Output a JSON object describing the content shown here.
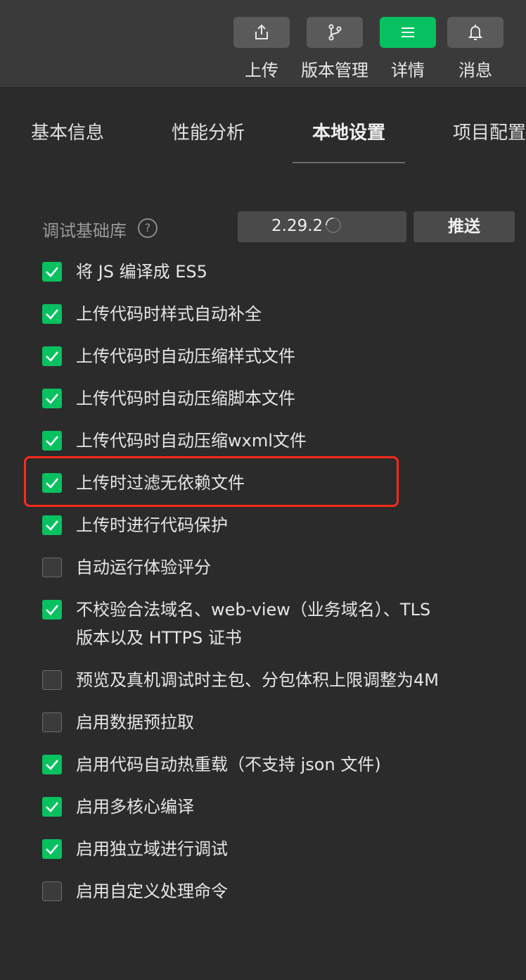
{
  "toolbar": {
    "buttons": [
      {
        "label": "上传",
        "icon": "upload-icon"
      },
      {
        "label": "版本管理",
        "icon": "branch-icon"
      },
      {
        "label": "详情",
        "icon": "menu-icon",
        "active": true
      },
      {
        "label": "消息",
        "icon": "bell-icon"
      }
    ]
  },
  "tabs": [
    "基本信息",
    "性能分析",
    "本地设置",
    "项目配置"
  ],
  "active_tab": "本地设置",
  "debug_lib": {
    "label": "调试基础库",
    "help": "?",
    "version": "2.29.2",
    "push_label": "推送"
  },
  "options": [
    {
      "label": "将 JS 编译成 ES5",
      "checked": true
    },
    {
      "label": "上传代码时样式自动补全",
      "checked": true
    },
    {
      "label": "上传代码时自动压缩样式文件",
      "checked": true
    },
    {
      "label": "上传代码时自动压缩脚本文件",
      "checked": true
    },
    {
      "label": "上传代码时自动压缩wxml文件",
      "checked": true
    },
    {
      "label": "上传时过滤无依赖文件",
      "checked": true
    },
    {
      "label": "上传时进行代码保护",
      "checked": true
    },
    {
      "label": "自动运行体验评分",
      "checked": false
    },
    {
      "label": "不校验合法域名、web-view（业务域名）、TLS\n版本以及 HTTPS 证书",
      "checked": true
    },
    {
      "label": "预览及真机调试时主包、分包体积上限调整为4M",
      "checked": false
    },
    {
      "label": "启用数据预拉取",
      "checked": false
    },
    {
      "label": "启用代码自动热重载（不支持 json 文件)",
      "checked": true
    },
    {
      "label": "启用多核心编译",
      "checked": true
    },
    {
      "label": "启用独立域进行调试",
      "checked": true
    },
    {
      "label": "启用自定义处理命令",
      "checked": false
    }
  ],
  "colors": {
    "accent": "#07c160",
    "highlight": "#ff2a1a",
    "background": "#2b2b2b"
  }
}
